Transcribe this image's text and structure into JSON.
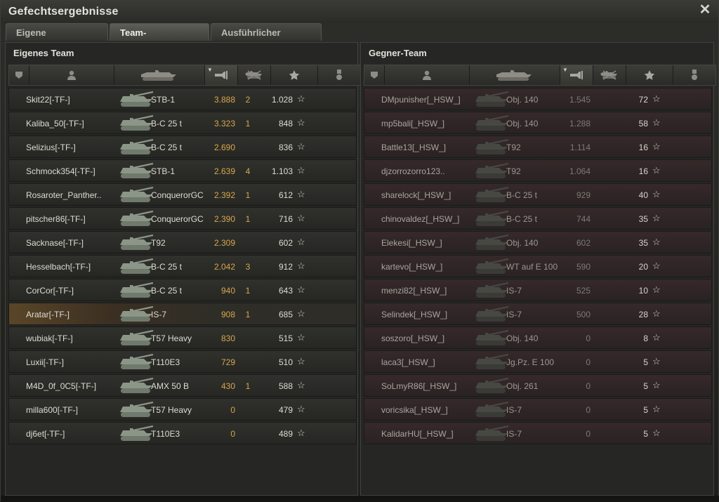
{
  "window": {
    "title": "Gefechtsergebnisse"
  },
  "tabs": [
    {
      "label": "Eigene Auswertung"
    },
    {
      "label": "Team-Auswertung"
    },
    {
      "label": "Ausführlicher Bericht"
    }
  ],
  "own_team": {
    "title": "Eigenes Team",
    "rows": [
      {
        "player": "Skit22[-TF-]",
        "tank": "STB-1",
        "damage": "3.888",
        "kills": "2",
        "xp": "1.028"
      },
      {
        "player": "Kaliba_50[-TF-]",
        "tank": "B-C 25 t",
        "damage": "3.323",
        "kills": "1",
        "xp": "848"
      },
      {
        "player": "Selizius[-TF-]",
        "tank": "B-C 25 t",
        "damage": "2.690",
        "kills": "",
        "xp": "836"
      },
      {
        "player": "Schmock354[-TF-]",
        "tank": "STB-1",
        "damage": "2.639",
        "kills": "4",
        "xp": "1.103"
      },
      {
        "player": "Rosaroter_Panther..",
        "tank": "ConquerorGC",
        "damage": "2.392",
        "kills": "1",
        "xp": "612"
      },
      {
        "player": "pitscher86[-TF-]",
        "tank": "ConquerorGC",
        "damage": "2.390",
        "kills": "1",
        "xp": "716"
      },
      {
        "player": "Sacknase[-TF-]",
        "tank": "T92",
        "damage": "2.309",
        "kills": "",
        "xp": "602"
      },
      {
        "player": "Hesselbach[-TF-]",
        "tank": "B-C 25 t",
        "damage": "2.042",
        "kills": "3",
        "xp": "912"
      },
      {
        "player": "CorCor[-TF-]",
        "tank": "B-C 25 t",
        "damage": "940",
        "kills": "1",
        "xp": "643"
      },
      {
        "player": "Aratar[-TF-]",
        "tank": "IS-7",
        "damage": "908",
        "kills": "1",
        "xp": "685"
      },
      {
        "player": "wubiak[-TF-]",
        "tank": "T57 Heavy",
        "damage": "830",
        "kills": "",
        "xp": "515"
      },
      {
        "player": "Luxii[-TF-]",
        "tank": "T110E3",
        "damage": "729",
        "kills": "",
        "xp": "510"
      },
      {
        "player": "M4D_0f_0C5[-TF-]",
        "tank": "AMX 50 B",
        "damage": "430",
        "kills": "1",
        "xp": "588"
      },
      {
        "player": "milla600[-TF-]",
        "tank": "T57 Heavy",
        "damage": "0",
        "kills": "",
        "xp": "479"
      },
      {
        "player": "dj6et[-TF-]",
        "tank": "T110E3",
        "damage": "0",
        "kills": "",
        "xp": "489"
      }
    ]
  },
  "enemy_team": {
    "title": "Gegner-Team",
    "rows": [
      {
        "player": "DMpunisher[_HSW_]",
        "tank": "Obj. 140",
        "damage": "1.545",
        "kills": "",
        "xp": "72"
      },
      {
        "player": "mp5bali[_HSW_]",
        "tank": "Obj. 140",
        "damage": "1.288",
        "kills": "",
        "xp": "58"
      },
      {
        "player": "Battle13[_HSW_]",
        "tank": "T92",
        "damage": "1.114",
        "kills": "",
        "xp": "16"
      },
      {
        "player": "djzorrozorro123..",
        "tank": "T92",
        "damage": "1.064",
        "kills": "",
        "xp": "16"
      },
      {
        "player": "sharelock[_HSW_]",
        "tank": "B-C 25 t",
        "damage": "929",
        "kills": "",
        "xp": "40"
      },
      {
        "player": "chinovaldez[_HSW_]",
        "tank": "B-C 25 t",
        "damage": "744",
        "kills": "",
        "xp": "35"
      },
      {
        "player": "Elekesi[_HSW_]",
        "tank": "Obj. 140",
        "damage": "602",
        "kills": "",
        "xp": "35"
      },
      {
        "player": "kartevo[_HSW_]",
        "tank": "WT auf E 100",
        "damage": "590",
        "kills": "",
        "xp": "20"
      },
      {
        "player": "menzi82[_HSW_]",
        "tank": "IS-7",
        "damage": "525",
        "kills": "",
        "xp": "10"
      },
      {
        "player": "Selindek[_HSW_]",
        "tank": "IS-7",
        "damage": "500",
        "kills": "",
        "xp": "28"
      },
      {
        "player": "soszoro[_HSW_]",
        "tank": "Obj. 140",
        "damage": "0",
        "kills": "",
        "xp": "8"
      },
      {
        "player": "laca3[_HSW_]",
        "tank": "Jg.Pz. E 100",
        "damage": "0",
        "kills": "",
        "xp": "5"
      },
      {
        "player": "SoLmyR86[_HSW_]",
        "tank": "Obj. 261",
        "damage": "0",
        "kills": "",
        "xp": "5"
      },
      {
        "player": "voricsika[_HSW_]",
        "tank": "IS-7",
        "damage": "0",
        "kills": "",
        "xp": "5"
      },
      {
        "player": "KalidarHU[_HSW_]",
        "tank": "IS-7",
        "damage": "0",
        "kills": "",
        "xp": "5"
      }
    ]
  },
  "columns": [
    {
      "icon": "squad-icon"
    },
    {
      "icon": "player-icon"
    },
    {
      "icon": "tank-icon"
    },
    {
      "icon": "damage-icon"
    },
    {
      "icon": "kills-icon"
    },
    {
      "icon": "xp-star-icon"
    },
    {
      "icon": "medal-icon"
    }
  ],
  "colors": {
    "accent": "#d8a54c",
    "highlight_row": "#5a4528",
    "enemy_row": "#36292a"
  }
}
